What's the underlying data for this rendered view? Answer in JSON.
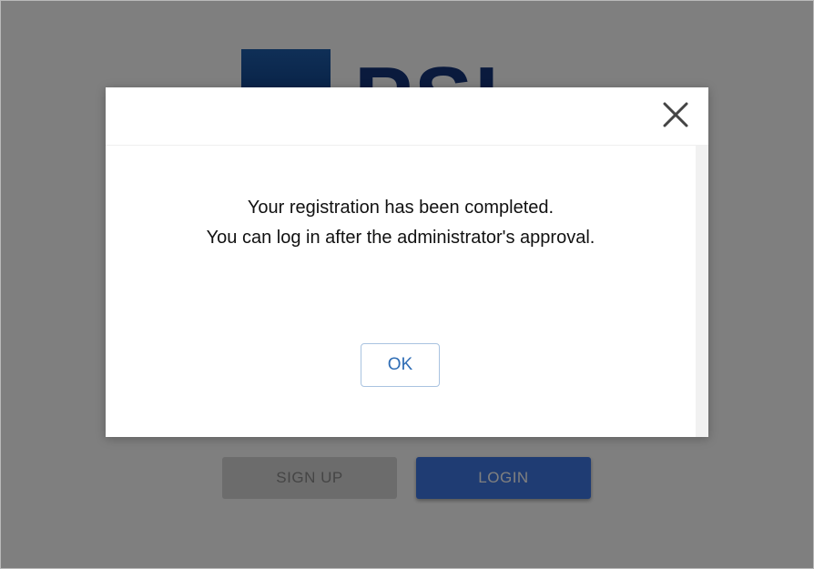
{
  "background": {
    "logo_text": "PSI",
    "signup_label": "SIGN UP",
    "login_label": "LOGIN"
  },
  "dialog": {
    "close_icon": "close-icon",
    "message_line1": "Your registration has been completed.",
    "message_line2": "You can log in after the administrator's approval.",
    "ok_label": "OK"
  },
  "colors": {
    "overlay": "#808080",
    "login_button": "#3f79e6",
    "signup_button": "#d9d9d9",
    "ok_text": "#2f6db5",
    "logo": "#14357a"
  }
}
